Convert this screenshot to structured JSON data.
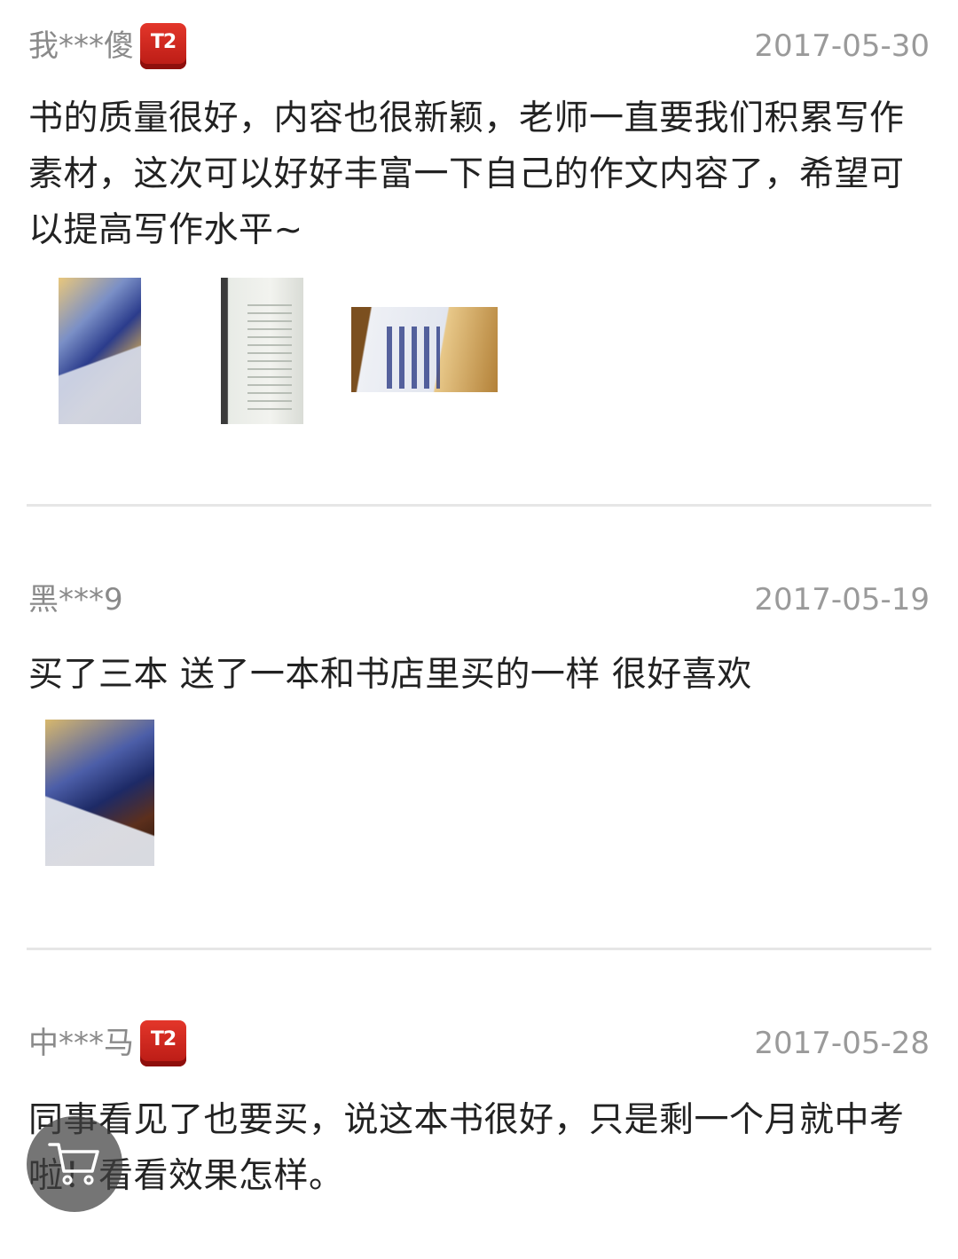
{
  "reviews": [
    {
      "username": "我***傻",
      "level_badge": "T2",
      "date": "2017-05-30",
      "text": "书的质量很好，内容也很新颖，老师一直要我们积累写作素材，这次可以好好丰富一下自己的作文内容了，希望可以提高写作水平~"
    },
    {
      "username": "黑***9",
      "date": "2017-05-19",
      "text": "买了三本 送了一本和书店里买的一样 很好喜欢"
    },
    {
      "username": "中***马",
      "level_badge": "T2",
      "date": "2017-05-28",
      "text": "同事看见了也要买，说这本书很好，只是剩一个月就中考啦！看看效果怎样。"
    }
  ],
  "floating_button": {
    "icon": "shopping-cart-icon"
  },
  "colors": {
    "username": "#8a8a8a",
    "date": "#9a9a9a",
    "body_text": "#222222",
    "badge": "#d42a20",
    "divider": "#e6e6e6"
  }
}
